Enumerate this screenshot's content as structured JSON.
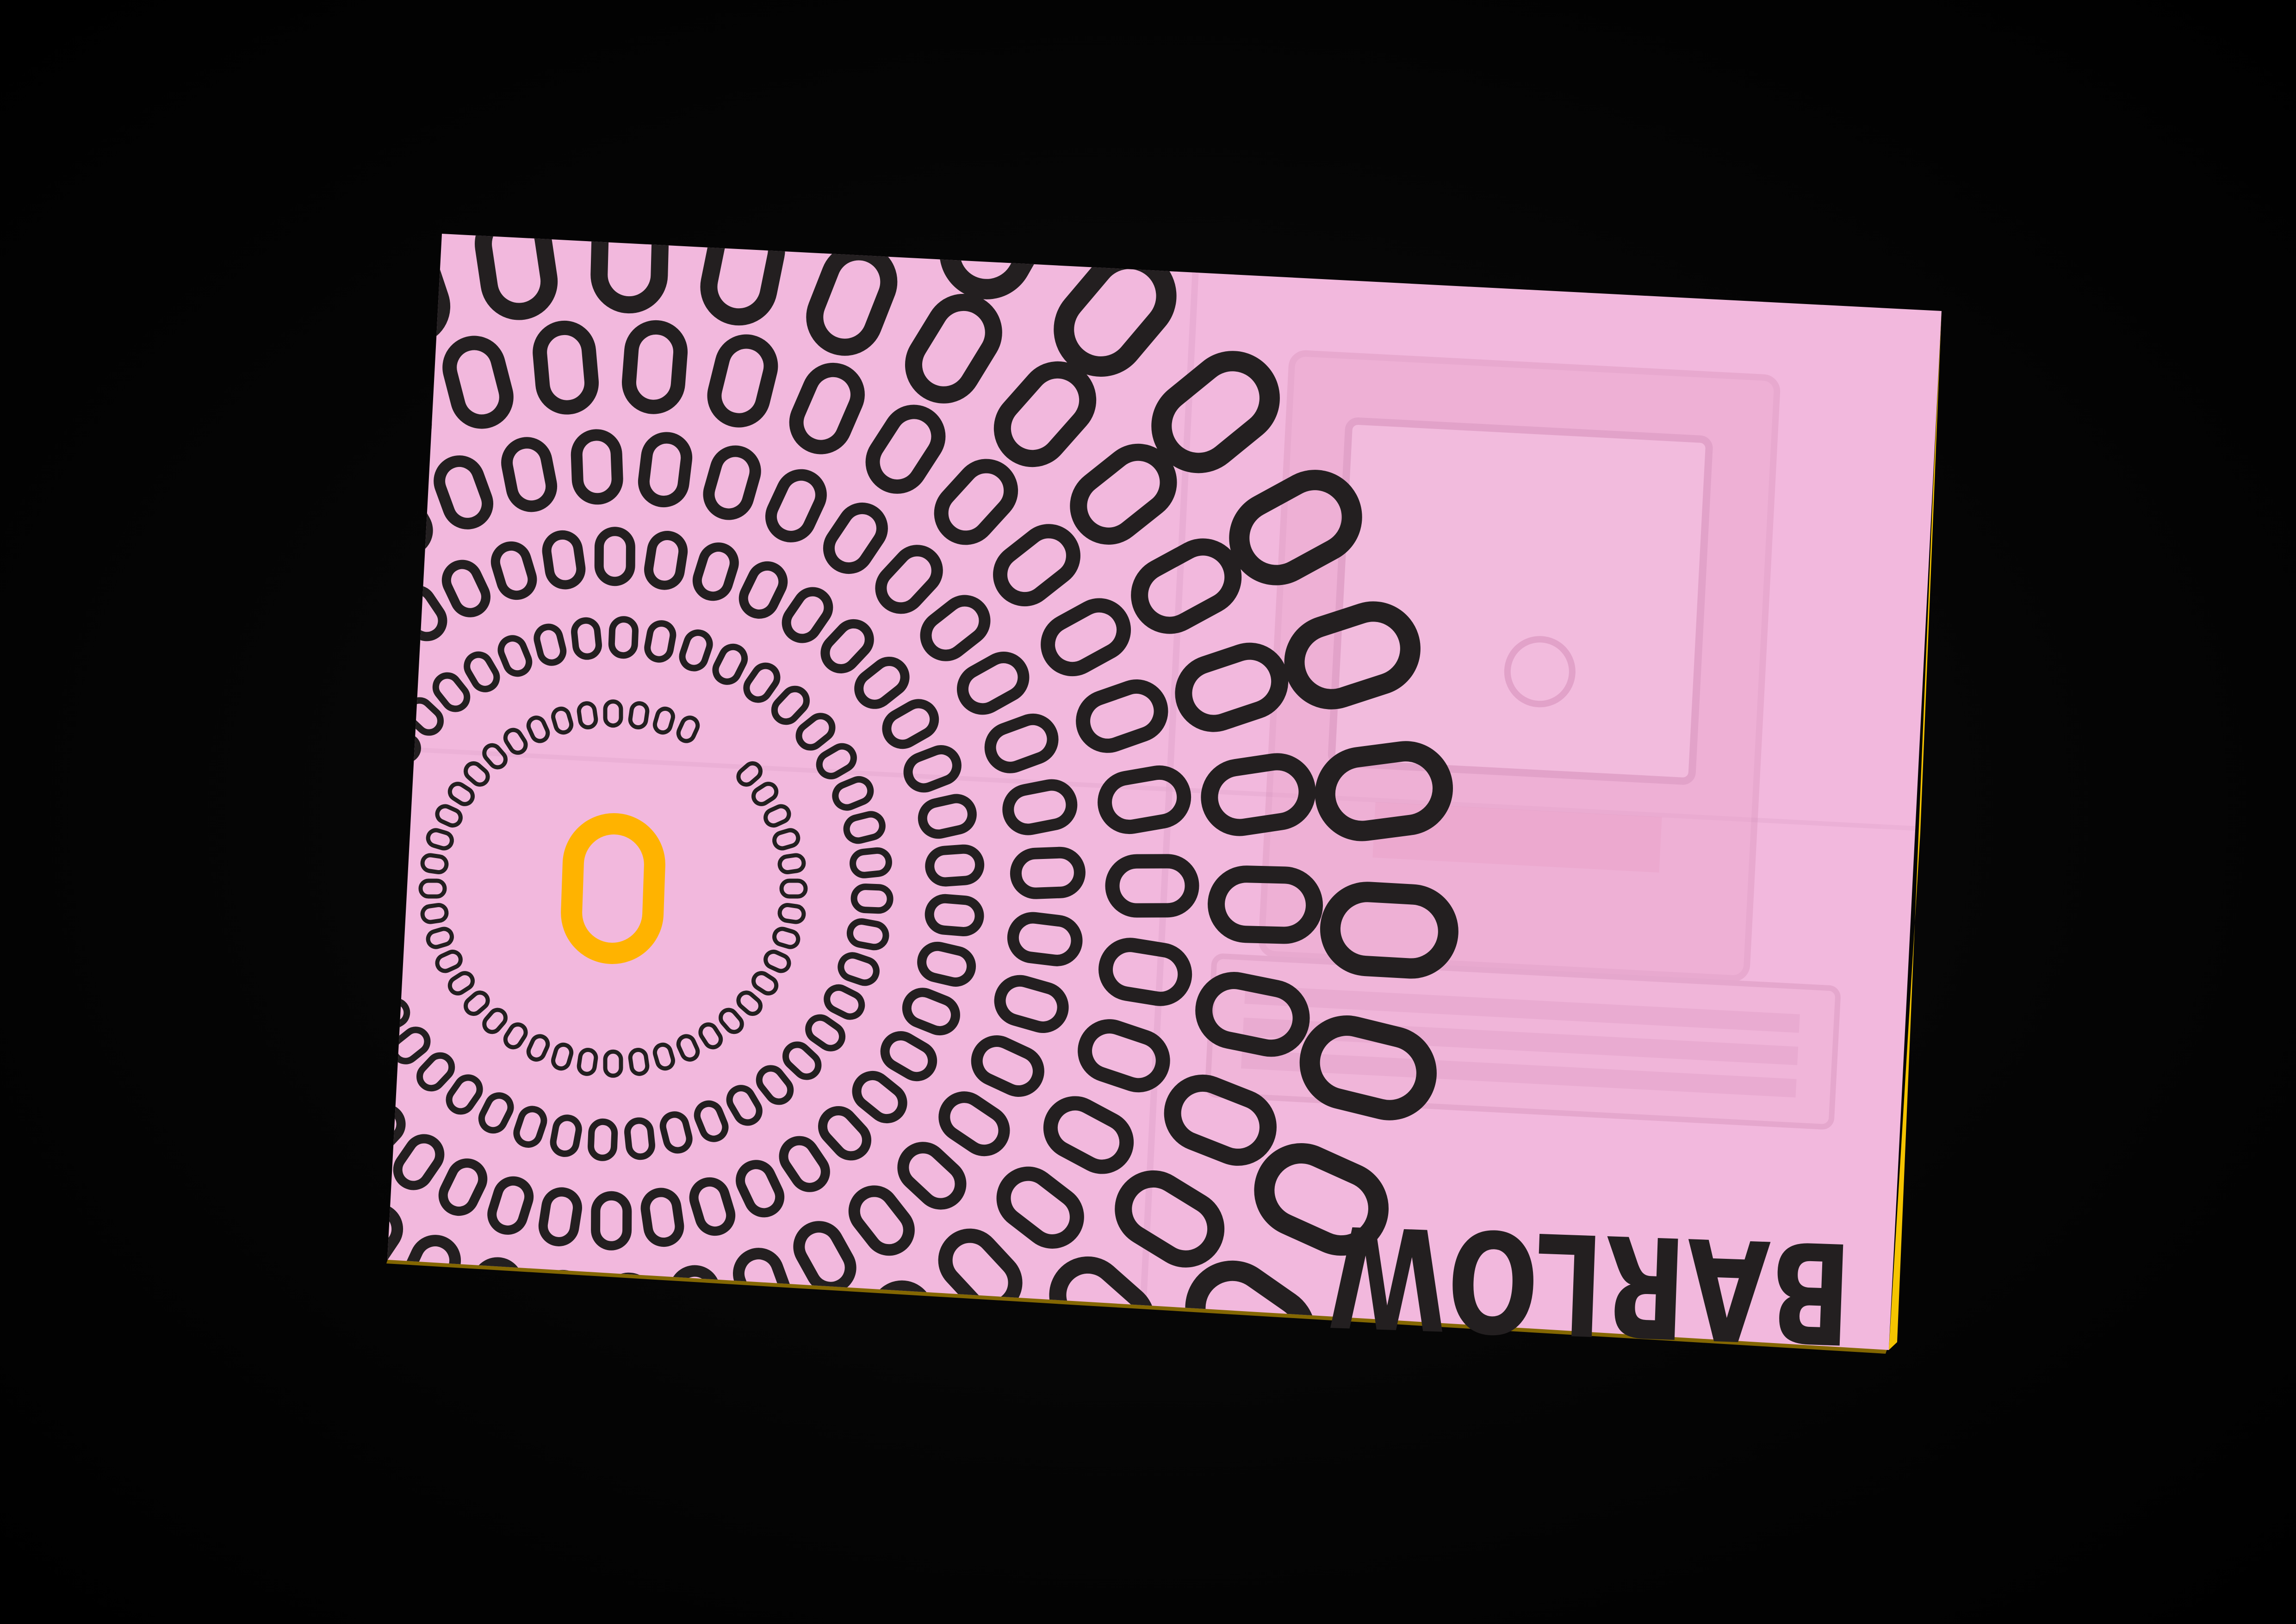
{
  "poster": {
    "title": "BARLOW",
    "center_glyph": "0",
    "ring_glyph": "0",
    "colors": {
      "background": "#050505",
      "paper": "#f2b8dd",
      "paper_shadow": "#e7a9d1",
      "ink": "#231f20",
      "accent": "#ffb300",
      "edge_yellow": "#f5c400"
    },
    "show_through_illustration": "computer-icon"
  }
}
